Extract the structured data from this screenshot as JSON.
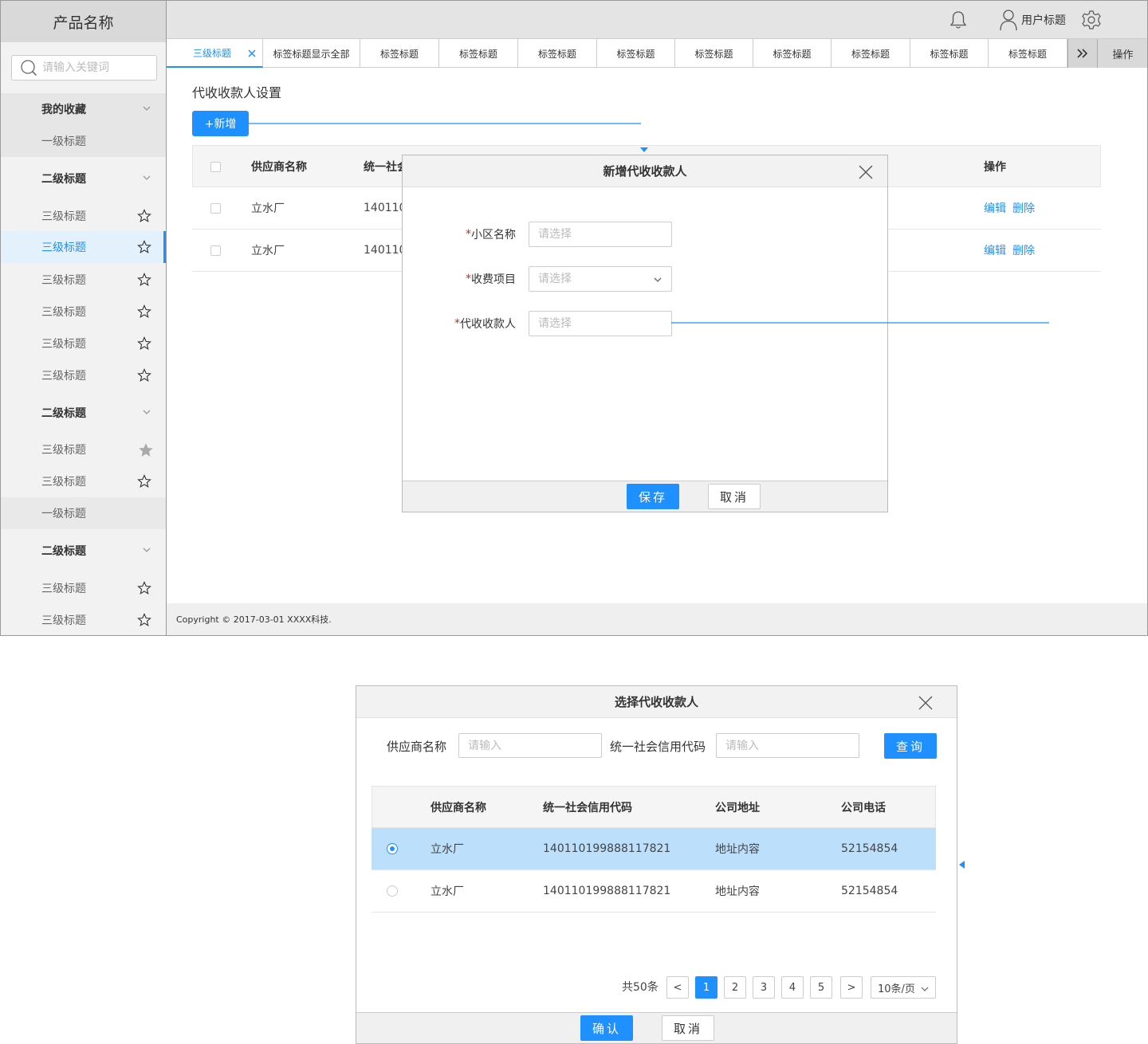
{
  "app": {
    "product_name": "产品名称",
    "search_placeholder": "请输入关键词",
    "user_label": "用户标题"
  },
  "sidebar": {
    "favorites": "我的收藏",
    "level1": "一级标题",
    "level2": "二级标题",
    "level3": "三级标题"
  },
  "tabs": {
    "active": "三级标题",
    "items": [
      "标签标题显示全部",
      "标签标题",
      "标签标题",
      "标签标题",
      "标签标题",
      "标签标题",
      "标签标题",
      "标签标题",
      "标签标题",
      "标签标题"
    ],
    "operations": "操作"
  },
  "page": {
    "title": "代收收款人设置",
    "add_button": "+新增",
    "footer": "Copyright © 2017-03-01 XXXX科技."
  },
  "main_table": {
    "columns": [
      "供应商名称",
      "统一社会",
      "操作"
    ],
    "rows": [
      {
        "name": "立水厂",
        "code": "140110"
      },
      {
        "name": "立水厂",
        "code": "140110"
      }
    ],
    "edit": "编辑",
    "delete": "删除"
  },
  "modal_add": {
    "title": "新增代收收款人",
    "fields": [
      {
        "label": "小区名称",
        "placeholder": "请选择"
      },
      {
        "label": "收费项目",
        "placeholder": "请选择"
      },
      {
        "label": "代收收款人",
        "placeholder": "请选择"
      }
    ],
    "required_mark": "*",
    "save": "保存",
    "cancel": "取消"
  },
  "modal_select": {
    "title": "选择代收收款人",
    "q_name_label": "供应商名称",
    "q_name_placeholder": "请输入",
    "q_code_label": "统一社会信用代码",
    "q_code_placeholder": "请输入",
    "query": "查询",
    "columns": [
      "供应商名称",
      "统一社会信用代码",
      "公司地址",
      "公司电话"
    ],
    "rows": [
      {
        "name": "立水厂",
        "code": "140110199888117821",
        "address": "地址内容",
        "phone": "52154854",
        "selected": true
      },
      {
        "name": "立水厂",
        "code": "140110199888117821",
        "address": "地址内容",
        "phone": "52154854",
        "selected": false
      }
    ],
    "total": "共50条",
    "pages": [
      "1",
      "2",
      "3",
      "4",
      "5"
    ],
    "prev": "<",
    "next": ">",
    "page_size": "10条/页",
    "confirm": "确认",
    "cancel": "取消"
  },
  "colors": {
    "accent": "#1e90ff",
    "selected_row": "#bcdffc",
    "required": "#e02020"
  }
}
